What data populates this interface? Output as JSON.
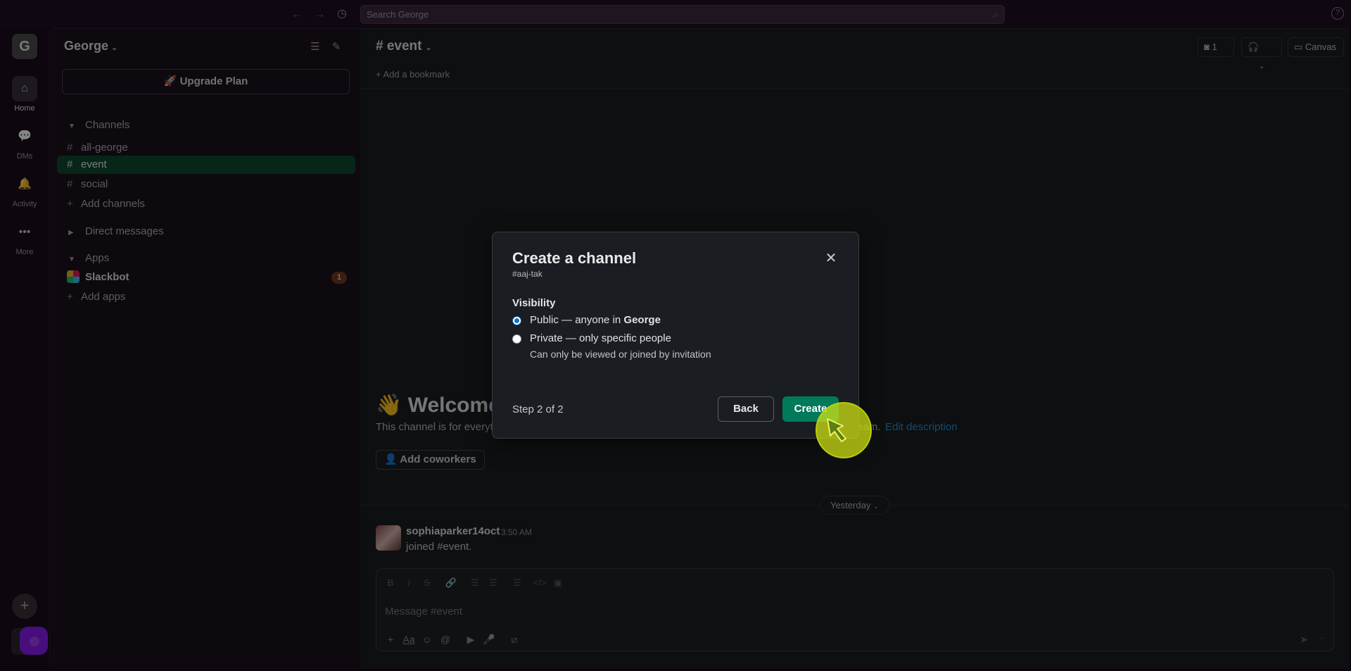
{
  "topbar": {
    "back_icon": "arrow-left-icon",
    "forward_icon": "arrow-right-icon",
    "history_icon": "clock-icon",
    "search_placeholder": "Search George",
    "help": "?"
  },
  "rail": {
    "workspace_initial": "G",
    "items": [
      {
        "label": "Home",
        "icon": "home-icon"
      },
      {
        "label": "DMs",
        "icon": "dm-icon"
      },
      {
        "label": "Activity",
        "icon": "bell-icon"
      },
      {
        "label": "More",
        "icon": "more-icon"
      }
    ],
    "add": "+"
  },
  "sidebar": {
    "workspace_name": "George",
    "upgrade_label": "Upgrade Plan",
    "channels_header": "Channels",
    "channels": [
      {
        "name": "all-george"
      },
      {
        "name": "event"
      },
      {
        "name": "social"
      }
    ],
    "add_channels": "Add channels",
    "direct_messages_header": "Direct messages",
    "apps_header": "Apps",
    "slackbot": "Slackbot",
    "slackbot_badge": "1",
    "add_apps": "Add apps"
  },
  "main": {
    "channel_title": "event",
    "huddle_count": "1",
    "canvas_label": "Canvas",
    "bookmark_label": "Add a bookmark",
    "welcome": "Welcome",
    "welcome_emoji": "👋",
    "desc_visible": "This channel is for everyth",
    "desc_tail": "team.",
    "edit_description": "Edit description",
    "add_coworkers": "Add coworkers",
    "day_divider": "Yesterday",
    "message": {
      "author": "sophiaparker14oct",
      "time": "3:50 AM",
      "text": "joined #event."
    },
    "composer_placeholder": "Message #event"
  },
  "modal": {
    "title": "Create a channel",
    "subtitle": "#aaj-tak",
    "visibility_label": "Visibility",
    "public_label_prefix": "Public — anyone in ",
    "public_label_ws": "George",
    "private_label": "Private — only specific people",
    "private_desc": "Can only be viewed or joined by invitation",
    "step": "Step 2 of 2",
    "back_label": "Back",
    "create_label": "Create",
    "selected": "public"
  }
}
